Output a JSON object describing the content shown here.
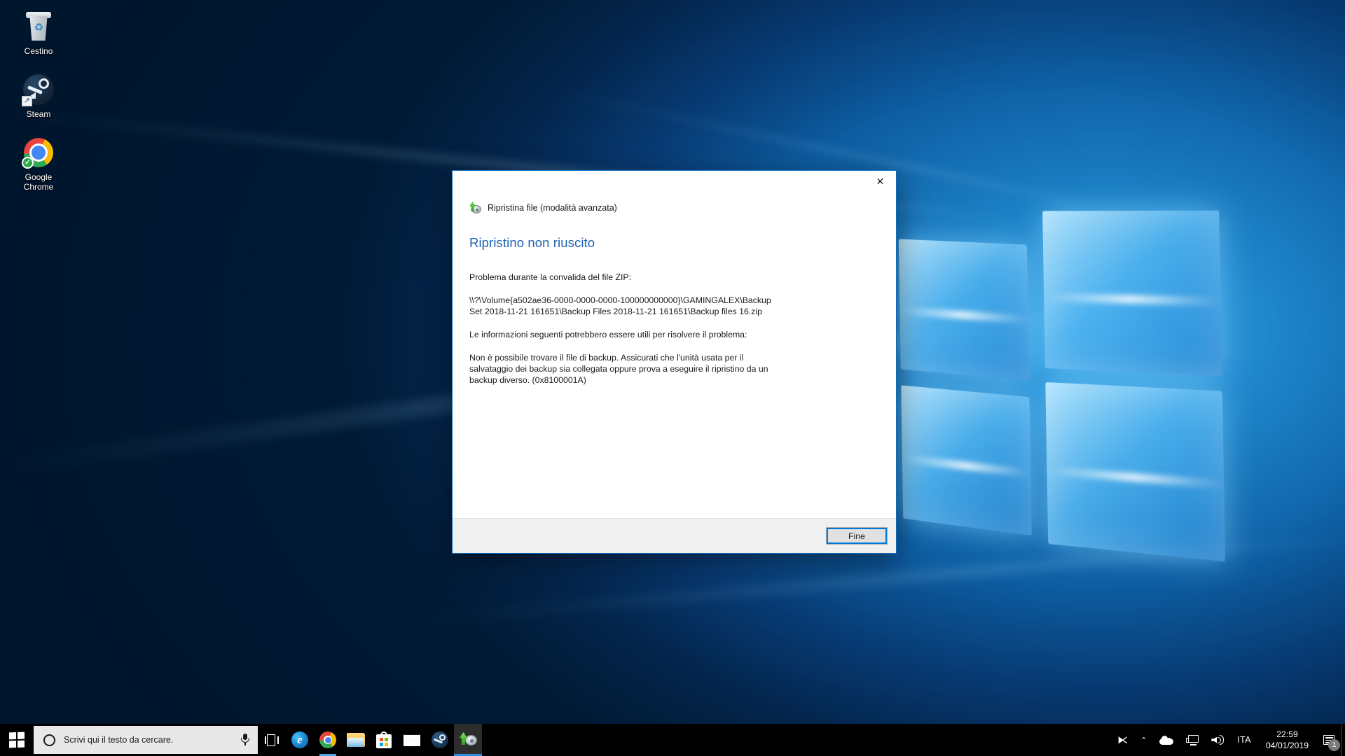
{
  "desktop": {
    "icons": [
      {
        "label": "Cestino",
        "icon": "recycle-bin-icon"
      },
      {
        "label": "Steam",
        "icon": "steam-icon"
      },
      {
        "label": "Google\nChrome",
        "label_line1": "Google",
        "label_line2": "Chrome",
        "icon": "chrome-icon"
      }
    ]
  },
  "dialog": {
    "app_title": "Ripristina file (modalità avanzata)",
    "app_icon": "restore-file-icon",
    "close_label": "✕",
    "heading": "Ripristino non riuscito",
    "paragraphs": {
      "intro": "Problema durante la convalida del file ZIP:",
      "path": "\\\\?\\Volume{a502ae36-0000-0000-0000-100000000000}\\GAMINGALEX\\Backup Set 2018-11-21 161651\\Backup Files 2018-11-21 161651\\Backup files 16.zip",
      "hint": "Le informazioni seguenti potrebbero essere utili per risolvere il problema:",
      "detail": "Non è possibile trovare il file di backup. Assicurati che l'unità usata per il salvataggio dei backup sia collegata oppure prova a eseguire il ripristino da un backup diverso. (0x8100001A)"
    },
    "error_code": "0x8100001A",
    "button_finish": "Fine",
    "accent_color": "#0f6cbd",
    "heading_color": "#1f63b0"
  },
  "taskbar": {
    "start_label": "Start",
    "search": {
      "placeholder": "Scrivi qui il testo da cercare.",
      "value": "Scrivi qui il testo da cercare.",
      "search_icon": "cortana-ring-icon",
      "mic_icon": "microphone-icon"
    },
    "items": [
      {
        "name": "task-view",
        "icon": "task-view-icon",
        "state": "idle"
      },
      {
        "name": "microsoft-edge",
        "icon": "edge-icon",
        "state": "idle",
        "glyph": "e"
      },
      {
        "name": "google-chrome",
        "icon": "chrome-icon",
        "state": "running"
      },
      {
        "name": "file-explorer",
        "icon": "folder-icon",
        "state": "idle"
      },
      {
        "name": "microsoft-store",
        "icon": "store-bag-icon",
        "state": "idle"
      },
      {
        "name": "mail",
        "icon": "mail-envelope-icon",
        "state": "idle"
      },
      {
        "name": "steam",
        "icon": "steam-icon",
        "state": "idle"
      },
      {
        "name": "backup-restore",
        "icon": "restore-file-icon",
        "state": "active"
      }
    ],
    "tray": {
      "people_icon": "people-icon",
      "people_glyph": "⧔",
      "chevron_glyph": "⌃",
      "onedrive_icon": "onedrive-cloud-icon",
      "network_icon": "network-monitor-icon",
      "volume_icon": "speaker-icon",
      "language": "ITA",
      "time": "22:59",
      "date": "04/01/2019",
      "notifications_icon": "action-center-icon",
      "notifications_count": "1"
    }
  }
}
